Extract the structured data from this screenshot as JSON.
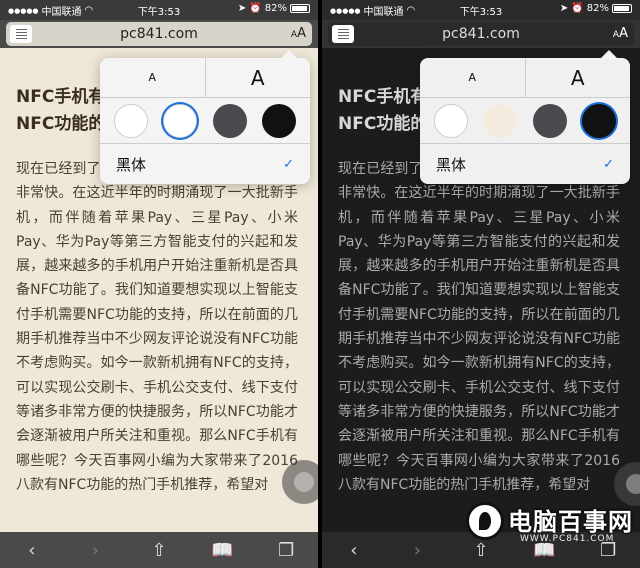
{
  "status": {
    "carrier": "中国联通",
    "time": "下午3:53",
    "battery": "82%"
  },
  "address": {
    "url": "pc841.com",
    "aa_small": "A",
    "aa_big": "A"
  },
  "article": {
    "title_left": "NFC手机有",
    "title_left_2": "NFC功能的",
    "title_right": "NFC手机有",
    "title_right_2": "NFC功能的",
    "body": "现在已经到了智能支付时代，移动支付发展得非常快。在这近半年的时期涌现了一大批新手机，而伴随着苹果Pay、三星Pay、小米Pay、华为Pay等第三方智能支付的兴起和发展，越来越多的手机用户开始注重新机是否具备NFC功能了。我们知道要想实现以上智能支付手机需要NFC功能的支持，所以在前面的几期手机推荐当中不少网友评论说没有NFC功能不考虑购买。如今一款新机拥有NFC的支持，可以实现公交刷卡、手机公交支付、线下支付等诸多非常方便的快捷服务，所以NFC功能才会逐渐被用户所关注和重视。那么NFC手机有哪些呢？今天百事网小编为大家带来了2016八款有NFC功能的热门手机推荐，希望对"
  },
  "popover": {
    "font_small": "A",
    "font_large": "A",
    "font_name": "黑体",
    "check": "✓",
    "swatches": [
      "#ffffff",
      "#f3ebdd",
      "#4a4a4e",
      "#111111"
    ],
    "selected_left": 1,
    "selected_right": 3
  },
  "toolbar": {
    "back": "‹",
    "forward": "›",
    "share": "⇧",
    "bookmarks": "📖",
    "tabs": "❐"
  },
  "watermark": {
    "title": "电脑百事网",
    "url": "WWW.PC841.COM"
  }
}
